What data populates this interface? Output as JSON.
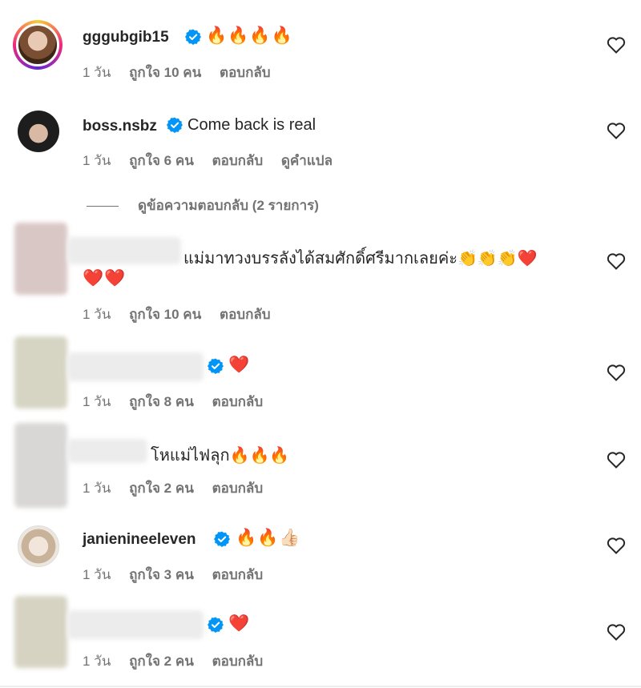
{
  "colors": {
    "text": "#262626",
    "secondary": "#737373",
    "verified": "#0095f6"
  },
  "comments": [
    {
      "username": "gggubgib15",
      "verified": true,
      "text": "🔥🔥🔥🔥",
      "time": "1 วัน",
      "likes": "ถูกใจ 10 คน",
      "reply": "ตอบกลับ"
    },
    {
      "username": "boss.nsbz",
      "verified": true,
      "text": "Come back is real",
      "time": "1 วัน",
      "likes": "ถูกใจ 6 คน",
      "reply": "ตอบกลับ",
      "translate": "ดูคำแปล"
    },
    {
      "username": "",
      "verified": false,
      "text": "แม่มาทวงบรรลังได้สมศักดิ์ศรีมากเลยค่ะ👏👏👏❤️",
      "text2": "❤️❤️",
      "time": "1 วัน",
      "likes": "ถูกใจ 10 คน",
      "reply": "ตอบกลับ"
    },
    {
      "username": "",
      "verified": true,
      "text": "❤️",
      "time": "1 วัน",
      "likes": "ถูกใจ 8 คน",
      "reply": "ตอบกลับ"
    },
    {
      "username": "",
      "verified": false,
      "text": "โหแม่ไฟลุก🔥🔥🔥",
      "time": "1 วัน",
      "likes": "ถูกใจ 2 คน",
      "reply": "ตอบกลับ"
    },
    {
      "username": "janienineeleven",
      "verified": true,
      "text": "🔥🔥👍🏻",
      "time": "1 วัน",
      "likes": "ถูกใจ 3 คน",
      "reply": "ตอบกลับ"
    },
    {
      "username": "",
      "verified": true,
      "text": "❤️",
      "time": "1 วัน",
      "likes": "ถูกใจ 2 คน",
      "reply": "ตอบกลับ"
    }
  ],
  "view_replies": "ดูข้อความตอบกลับ (2 รายการ)",
  "icons": {
    "like": "heart-outline-icon",
    "verified": "verified-badge-icon"
  }
}
